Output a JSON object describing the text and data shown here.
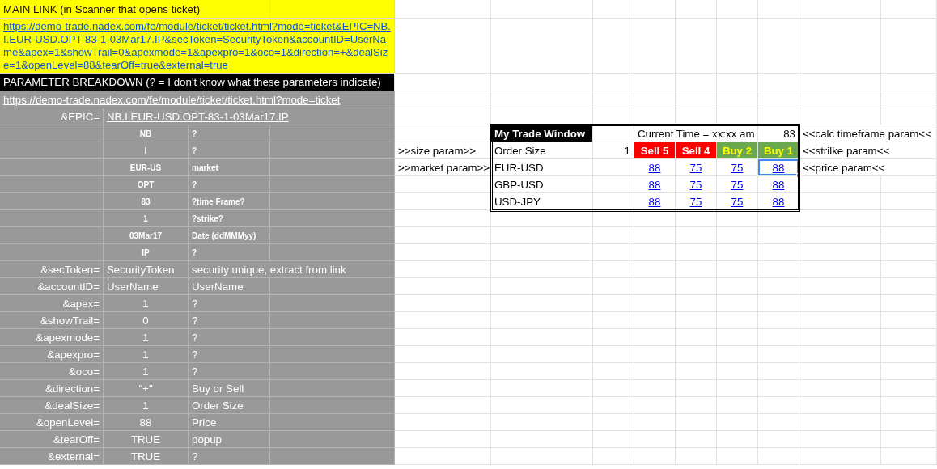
{
  "main_link": {
    "title": "MAIN LINK (in Scanner that opens ticket)",
    "url": "https://demo-trade.nadex.com/fe/module/ticket/ticket.html?mode=ticket&EPIC=NB.I.EUR-USD.OPT-83-1-03Mar17.IP&secToken=SecurityToken&accountID=UserName&apex=1&showTrail=0&apexmode=1&apexpro=1&oco=1&direction=+&dealSize=1&openLevel=88&tearOff=true&external=true"
  },
  "parameter_breakdown": {
    "title": "PARAMETER BREAKDOWN (? = I don't know what these parameters indicate)",
    "base_url": "https://demo-trade.nadex.com/fe/module/ticket/ticket.html?mode=ticket",
    "epic_label": "&EPIC=",
    "epic_value": "NB.I.EUR-USD.OPT-83-1-03Mar17.IP",
    "epic_parts": [
      {
        "value": "NB",
        "note": "?"
      },
      {
        "value": "I",
        "note": "?"
      },
      {
        "value": "EUR-US",
        "note": "market"
      },
      {
        "value": "OPT",
        "note": "?"
      },
      {
        "value": "83",
        "note": "?time Frame?"
      },
      {
        "value": "1",
        "note": "?strike?"
      },
      {
        "value": "03Mar17",
        "note": "Date (ddMMMyy)"
      },
      {
        "value": "IP",
        "note": "?"
      }
    ],
    "params": [
      {
        "name": "&secToken=",
        "value": "SecurityToken",
        "note": "security unique, extract from link",
        "left_aligned": true
      },
      {
        "name": "&accountID=",
        "value": "UserName",
        "note": "UserName",
        "left_aligned": true
      },
      {
        "name": "&apex=",
        "value": "1",
        "note": "?",
        "left_aligned": false
      },
      {
        "name": "&showTrail=",
        "value": "0",
        "note": "?",
        "left_aligned": false
      },
      {
        "name": "&apexmode=",
        "value": "1",
        "note": "?",
        "left_aligned": false
      },
      {
        "name": "&apexpro=",
        "value": "1",
        "note": "?",
        "left_aligned": false
      },
      {
        "name": "&oco=",
        "value": "1",
        "note": "?",
        "left_aligned": false
      },
      {
        "name": "&direction=",
        "value": "\"+\"",
        "note": "Buy or Sell",
        "left_aligned": false
      },
      {
        "name": "&dealSize=",
        "value": "1",
        "note": "Order Size",
        "left_aligned": false
      },
      {
        "name": "&openLevel=",
        "value": "88",
        "note": "Price",
        "left_aligned": false
      },
      {
        "name": "&tearOff=",
        "value": "TRUE",
        "note": "popup",
        "left_aligned": false
      },
      {
        "name": "&external=",
        "value": "TRUE",
        "note": "?",
        "left_aligned": false
      }
    ]
  },
  "trade_window": {
    "title": "My Trade Window",
    "current_time": "Current Time = xx:xx am",
    "timeframe": "83",
    "timeframe_note": "<<calc timeframe param<<",
    "size_note": ">>size param>>",
    "order_size_label": "Order Size",
    "order_size": "1",
    "strike_note": "<<strilke param<<",
    "market_note": ">>market param>>",
    "price_note": "<<price param<<",
    "actions": [
      {
        "label": "Sell 5",
        "kind": "sell"
      },
      {
        "label": "Sell 4",
        "kind": "sell"
      },
      {
        "label": "Buy 2",
        "kind": "buy"
      },
      {
        "label": "Buy 1",
        "kind": "buy"
      }
    ],
    "markets": [
      {
        "name": "EUR-USD",
        "prices": [
          {
            "value": "88",
            "selected": false
          },
          {
            "value": "75",
            "selected": false
          },
          {
            "value": "75",
            "selected": false
          },
          {
            "value": "88",
            "selected": true
          }
        ]
      },
      {
        "name": "GBP-USD",
        "prices": [
          {
            "value": "88",
            "selected": false
          },
          {
            "value": "75",
            "selected": false
          },
          {
            "value": "75",
            "selected": false
          },
          {
            "value": "88",
            "selected": false
          }
        ]
      },
      {
        "name": "USD-JPY",
        "prices": [
          {
            "value": "88",
            "selected": false
          },
          {
            "value": "75",
            "selected": false
          },
          {
            "value": "75",
            "selected": false
          },
          {
            "value": "88",
            "selected": false
          }
        ]
      }
    ]
  }
}
